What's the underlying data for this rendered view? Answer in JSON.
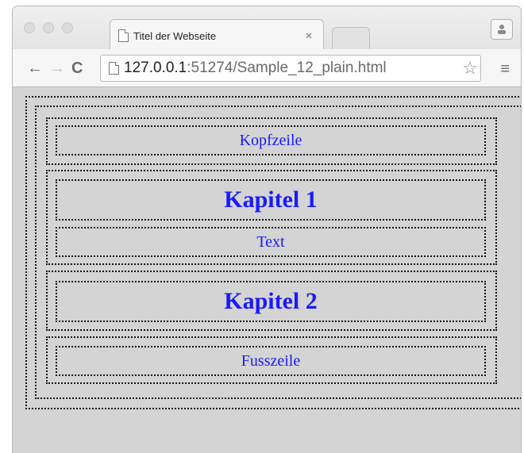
{
  "browser": {
    "tab_title": "Titel der Webseite",
    "tab_close": "×",
    "url_host": "127.0.0.1",
    "url_path": ":51274/Sample_12_plain.html"
  },
  "page": {
    "header": "Kopfzeile",
    "chapter1_title": "Kapitel 1",
    "chapter1_text": "Text",
    "chapter2_title": "Kapitel 2",
    "footer": "Fusszeile"
  },
  "colors": {
    "text_link_blue": "#1a1aff",
    "page_background": "#d4d4d4"
  }
}
